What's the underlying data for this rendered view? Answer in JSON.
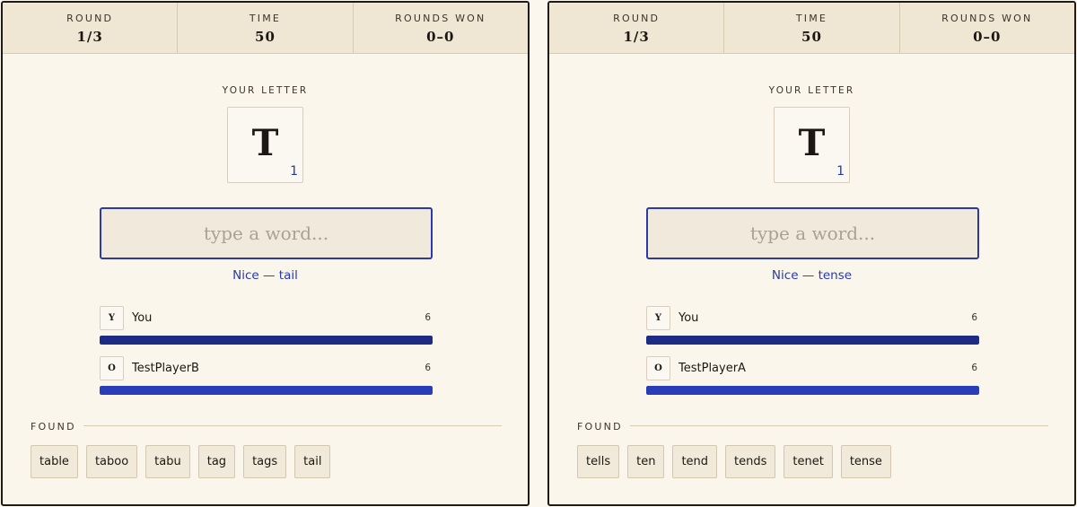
{
  "colors": {
    "accent": "#2a3aa8",
    "bar_you": "#1d2a86",
    "bar_opponent": "#2a3db8",
    "header_bg": "#efe6d4",
    "panel_bg": "#faf6ec"
  },
  "panels": [
    {
      "stats": [
        {
          "label": "ROUND",
          "value": "1/3"
        },
        {
          "label": "TIME",
          "value": "50"
        },
        {
          "label": "ROUNDS WON",
          "value": "0–0"
        }
      ],
      "your_letter_label": "YOUR LETTER",
      "letter": "T",
      "letter_score": "1",
      "input": {
        "value": "",
        "placeholder": "type a word..."
      },
      "feedback": "Nice — tail",
      "players": [
        {
          "badge": "Y",
          "name": "You",
          "score": "6",
          "progress": 1.0
        },
        {
          "badge": "O",
          "name": "TestPlayerB",
          "score": "6",
          "progress": 1.0
        }
      ],
      "found_label": "FOUND",
      "found_words": [
        "table",
        "taboo",
        "tabu",
        "tag",
        "tags",
        "tail"
      ]
    },
    {
      "stats": [
        {
          "label": "ROUND",
          "value": "1/3"
        },
        {
          "label": "TIME",
          "value": "50"
        },
        {
          "label": "ROUNDS WON",
          "value": "0–0"
        }
      ],
      "your_letter_label": "YOUR LETTER",
      "letter": "T",
      "letter_score": "1",
      "input": {
        "value": "",
        "placeholder": "type a word..."
      },
      "feedback": "Nice — tense",
      "players": [
        {
          "badge": "Y",
          "name": "You",
          "score": "6",
          "progress": 1.0
        },
        {
          "badge": "O",
          "name": "TestPlayerA",
          "score": "6",
          "progress": 1.0
        }
      ],
      "found_label": "FOUND",
      "found_words": [
        "tells",
        "ten",
        "tend",
        "tends",
        "tenet",
        "tense"
      ]
    }
  ]
}
